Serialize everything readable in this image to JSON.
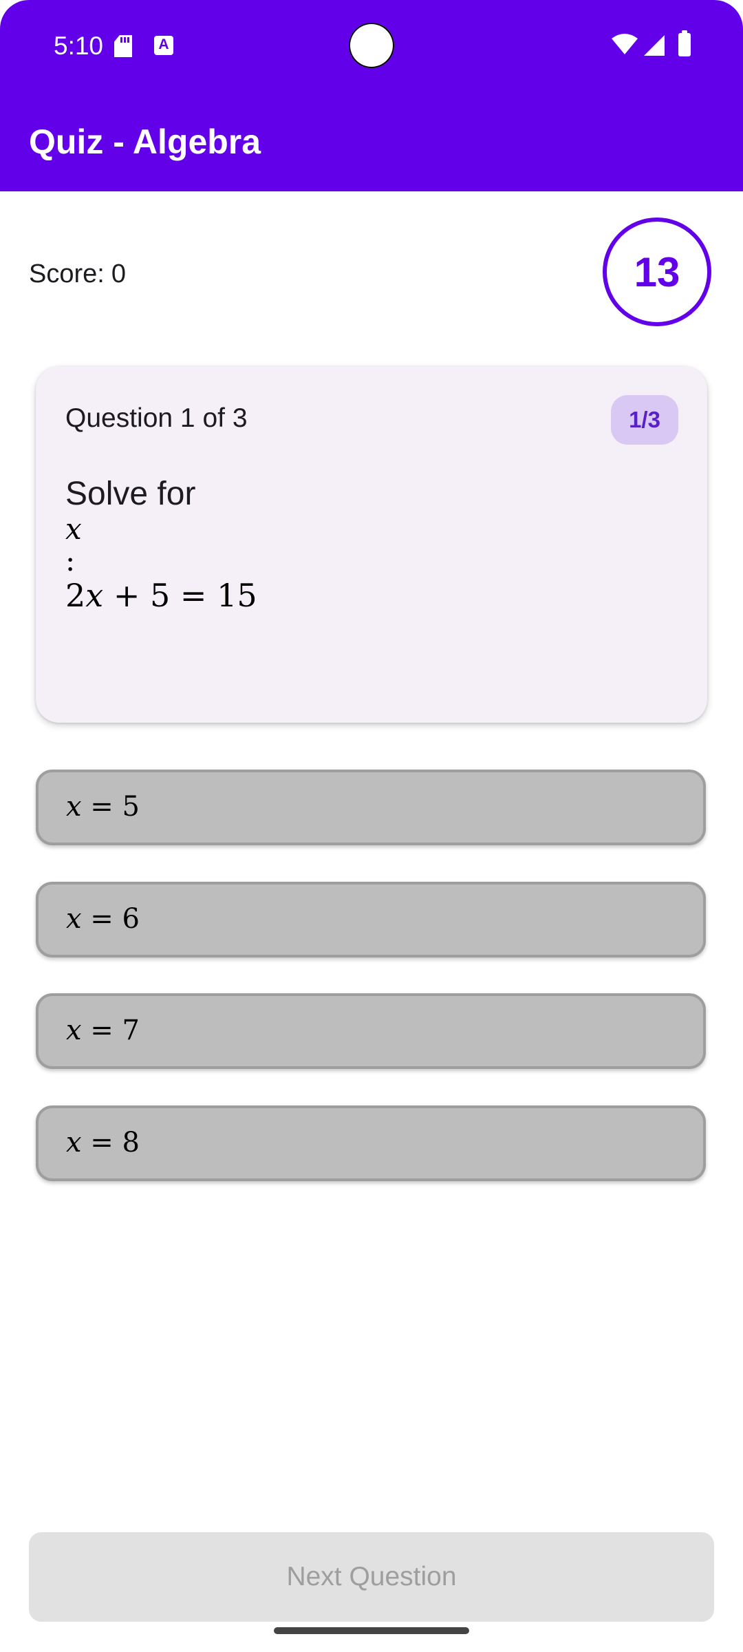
{
  "status_bar": {
    "time": "5:10",
    "icons": [
      "sd-card-icon",
      "text-a-icon",
      "camera-cutout",
      "wifi-icon",
      "signal-icon",
      "battery-icon"
    ]
  },
  "app_bar": {
    "title": "Quiz - Algebra",
    "color": "#6200ea"
  },
  "score": {
    "label": "Score:",
    "value": "0"
  },
  "timer": {
    "seconds": "13"
  },
  "question_card": {
    "title": "Question 1 of 3",
    "progress_badge": "1/3",
    "text_prefix": "Solve for",
    "variable": "x",
    "colon": ":",
    "eq_part1": "2",
    "eq_var": "x",
    "eq_part2": " + 5 = 15"
  },
  "options": [
    {
      "var": "x",
      "rest": " = 5"
    },
    {
      "var": "x",
      "rest": " = 6"
    },
    {
      "var": "x",
      "rest": " = 7"
    },
    {
      "var": "x",
      "rest": " = 8"
    }
  ],
  "next_button": {
    "label": "Next Question",
    "enabled": false
  },
  "colors": {
    "accent": "#6200ea",
    "option_bg": "#bdbdbd",
    "card_bg": "#f5f0f8"
  }
}
